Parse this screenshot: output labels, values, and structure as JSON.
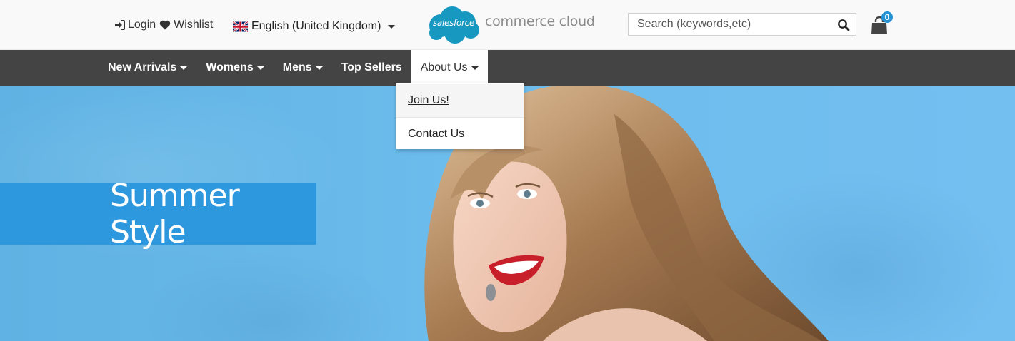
{
  "header": {
    "login_label": "Login",
    "wishlist_label": "Wishlist",
    "locale_label": "English (United Kingdom)",
    "logo_cloud_text": "salesforce",
    "logo_text": "commerce cloud",
    "search_placeholder": "Search (keywords,etc)",
    "cart_count": "0"
  },
  "nav": {
    "items": [
      {
        "label": "New Arrivals",
        "has_dropdown": true
      },
      {
        "label": "Womens",
        "has_dropdown": true
      },
      {
        "label": "Mens",
        "has_dropdown": true
      },
      {
        "label": "Top Sellers",
        "has_dropdown": false
      },
      {
        "label": "About Us",
        "has_dropdown": true,
        "active": true
      }
    ]
  },
  "dropdown": {
    "items": [
      {
        "label": "Join Us!",
        "hovered": true
      },
      {
        "label": "Contact Us"
      }
    ]
  },
  "hero": {
    "banner_title": "Summer Style"
  },
  "colors": {
    "nav_bg": "#444444",
    "accent_blue": "#2e98de",
    "badge_blue": "#2492d4",
    "hero_blue": "#6cbcec"
  },
  "icons": [
    "sign-in-icon",
    "heart-icon",
    "uk-flag-icon",
    "search-icon",
    "shopping-bag-icon"
  ]
}
